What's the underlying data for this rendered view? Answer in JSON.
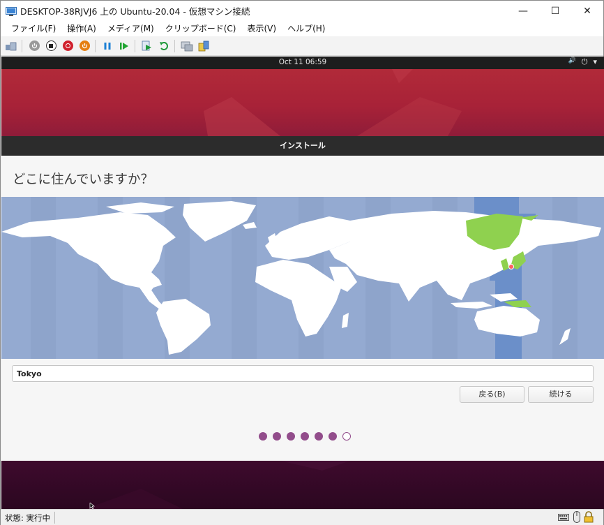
{
  "window": {
    "title": "DESKTOP-38RJVJ6 上の Ubuntu-20.04 - 仮想マシン接続",
    "controls": {
      "minimize": "—",
      "maximize": "☐",
      "close": "✕"
    }
  },
  "menu": [
    "ファイル(F)",
    "操作(A)",
    "メディア(M)",
    "クリップボード(C)",
    "表示(V)",
    "ヘルプ(H)"
  ],
  "toolbar": {
    "icons": [
      "ctrl-alt-del-icon",
      "start-icon",
      "turn-off-icon",
      "shutdown-icon",
      "save-icon",
      "pause-icon",
      "reset-icon",
      "checkpoint-icon",
      "revert-icon",
      "enhanced-session-icon",
      "share-icon"
    ]
  },
  "gnome": {
    "clock": "Oct 11  06:59",
    "tray": {
      "volume": "🔊",
      "power": "⏻",
      "arrow": "▾"
    }
  },
  "installer": {
    "header": "インストール",
    "question": "どこに住んでいますか？",
    "timezone_value": "Tokyo",
    "back_label": "戻る(B)",
    "continue_label": "続ける",
    "progress": {
      "steps": 7,
      "completed": 6
    }
  },
  "status": {
    "text": "状態: 実行中"
  },
  "colors": {
    "accent": "#924d8b",
    "selected_region": "#8fd14f",
    "ocean": "#94aad1",
    "selected_zone": "#6b8fc9"
  }
}
